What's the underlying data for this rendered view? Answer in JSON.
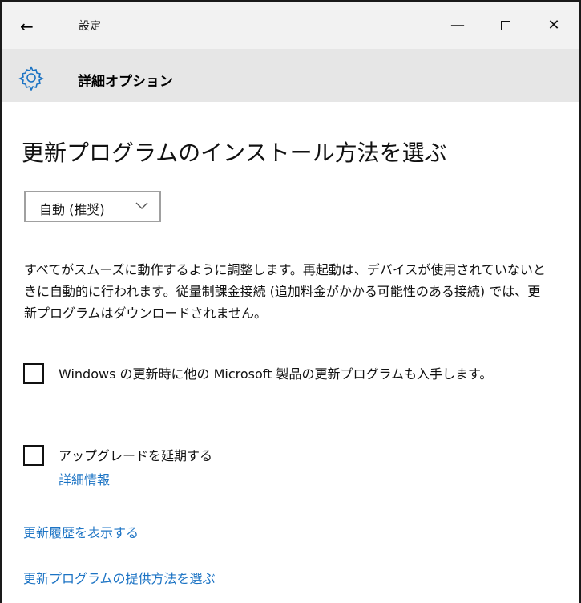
{
  "titlebar": {
    "back_icon": "←",
    "title": "設定",
    "minimize_icon": "—",
    "close_icon": "✕"
  },
  "header": {
    "icon": "gear-icon",
    "title": "詳細オプション"
  },
  "main": {
    "heading": "更新プログラムのインストール方法を選ぶ",
    "dropdown": {
      "selected": "自動 (推奨)"
    },
    "description": "すべてがスムーズに動作するように調整します。再起動は、デバイスが使用されていないときに自動的に行われます。従量制課金接続 (追加料金がかかる可能性のある接続) では、更新プログラムはダウンロードされません。",
    "options": [
      {
        "label": "Windows の更新時に他の Microsoft 製品の更新プログラムも入手します。",
        "checked": false
      },
      {
        "label": "アップグレードを延期する",
        "checked": false,
        "link": "詳細情報"
      }
    ],
    "links": {
      "history": "更新履歴を表示する",
      "delivery": "更新プログラムの提供方法を選ぶ"
    }
  },
  "colors": {
    "link": "#1b73c4",
    "header_bg": "#e6e6e6",
    "titlebar_bg": "#f2f2f2"
  }
}
